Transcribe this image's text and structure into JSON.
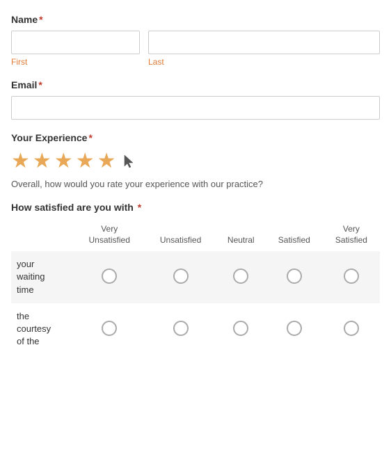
{
  "form": {
    "name_label": "Name",
    "required_marker": "*",
    "first_label": "First",
    "last_label": "Last",
    "email_label": "Email",
    "experience_label": "Your Experience",
    "experience_hint": "Overall, how would you rate your experience with our practice?",
    "stars_filled": 5,
    "satisfaction_label": "How satisfied are you with",
    "satisfaction_columns": [
      {
        "id": "very_unsatisfied",
        "line1": "Very",
        "line2": "Unsatisfied"
      },
      {
        "id": "unsatisfied",
        "line1": "",
        "line2": "Unsatisfied"
      },
      {
        "id": "neutral",
        "line1": "",
        "line2": "Neutral"
      },
      {
        "id": "satisfied",
        "line1": "",
        "line2": "Satisfied"
      },
      {
        "id": "very_satisfied",
        "line1": "Very",
        "line2": "Satisfied"
      }
    ],
    "satisfaction_rows": [
      {
        "id": "waiting_time",
        "label": "your waiting time",
        "shaded": true
      },
      {
        "id": "courtesy",
        "label": "the courtesy of the",
        "shaded": false
      }
    ]
  }
}
